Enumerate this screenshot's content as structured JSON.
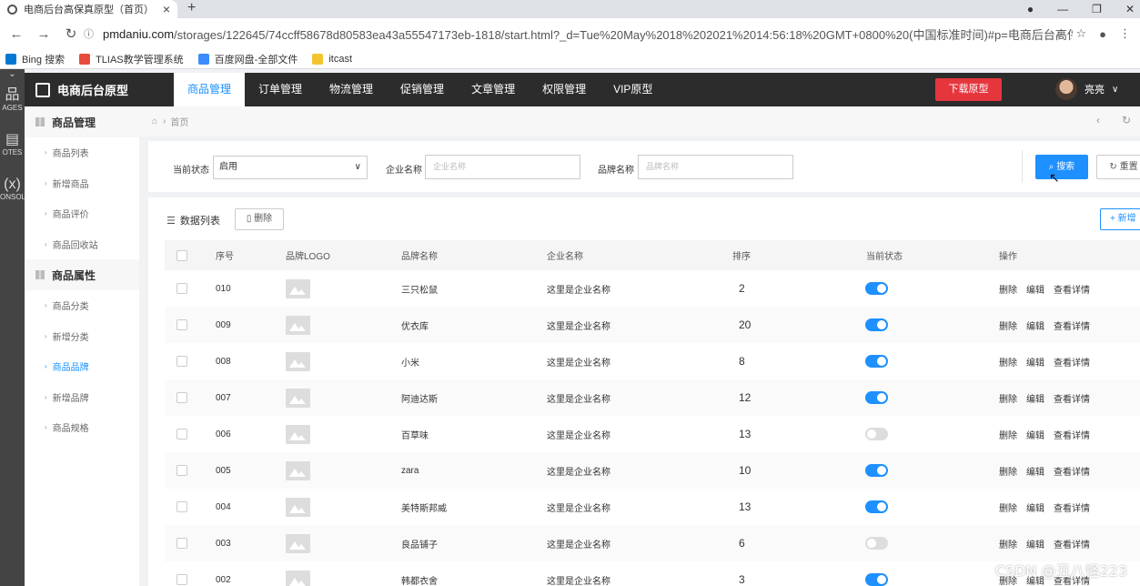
{
  "browser": {
    "tab_title": "电商后台高保真原型（首页）",
    "url_host": "pmdaniu.com",
    "url_path": "/storages/122645/74ccff58678d80583ea43a55547173eb-1818/start.html?_d=Tue%20May%2018%202021%2014:56:18%20GMT+0800%20(中国标准时间)#p=电商后台高保...",
    "bookmarks": [
      {
        "label": "Bing 搜索",
        "color": "#0078d4"
      },
      {
        "label": "TLIAS教学管理系统",
        "color": "#e74c3c"
      },
      {
        "label": "百度网盘-全部文件",
        "color": "#3b8cff"
      },
      {
        "label": "itcast",
        "color": "#f4c430"
      }
    ]
  },
  "axure": {
    "items": [
      {
        "glyph": "品",
        "label": "AGES"
      },
      {
        "glyph": "▤",
        "label": "OTES"
      },
      {
        "glyph": "(x)",
        "label": "ONSOL"
      }
    ]
  },
  "app": {
    "logo": "电商后台原型",
    "nav": [
      "商品管理",
      "订单管理",
      "物流管理",
      "促销管理",
      "文章管理",
      "权限管理",
      "VIP原型"
    ],
    "download": "下载原型",
    "user_name": "亮亮"
  },
  "sidebar": {
    "groups": [
      {
        "title": "商品管理",
        "items": [
          "商品列表",
          "新增商品",
          "商品评价",
          "商品回收站"
        ]
      },
      {
        "title": "商品属性",
        "items": [
          "商品分类",
          "新增分类",
          "商品品牌",
          "新增品牌",
          "商品规格"
        ]
      }
    ],
    "active": "商品品牌"
  },
  "breadcrumb": {
    "home_icon": "home-icon",
    "current": "首页"
  },
  "filter": {
    "status_label": "当前状态",
    "status_value": "启用",
    "company_label": "企业名称",
    "company_placeholder": "企业名称",
    "brand_label": "品牌名称",
    "brand_placeholder": "品牌名称",
    "search_btn": "搜索",
    "reset_btn": "重置"
  },
  "list": {
    "title": "数据列表",
    "delete_btn": "删除",
    "add_btn": "新增",
    "columns": [
      "序号",
      "品牌LOGO",
      "品牌名称",
      "企业名称",
      "排序",
      "当前状态",
      "操作"
    ],
    "ops": [
      "删除",
      "编辑",
      "查看详情"
    ],
    "rows": [
      {
        "id": "010",
        "brand": "三只松鼠",
        "company": "这里是企业名称",
        "sort": "2",
        "on": true
      },
      {
        "id": "009",
        "brand": "优衣库",
        "company": "这里是企业名称",
        "sort": "20",
        "on": true
      },
      {
        "id": "008",
        "brand": "小米",
        "company": "这里是企业名称",
        "sort": "8",
        "on": true
      },
      {
        "id": "007",
        "brand": "阿迪达斯",
        "company": "这里是企业名称",
        "sort": "12",
        "on": true
      },
      {
        "id": "006",
        "brand": "百草味",
        "company": "这里是企业名称",
        "sort": "13",
        "on": false
      },
      {
        "id": "005",
        "brand": "zara",
        "company": "这里是企业名称",
        "sort": "10",
        "on": true
      },
      {
        "id": "004",
        "brand": "美特斯邦威",
        "company": "这里是企业名称",
        "sort": "13",
        "on": true
      },
      {
        "id": "003",
        "brand": "良品铺子",
        "company": "这里是企业名称",
        "sort": "6",
        "on": false
      },
      {
        "id": "002",
        "brand": "韩都衣舍",
        "company": "这里是企业名称",
        "sort": "3",
        "on": true
      }
    ]
  },
  "watermark": "CSDN @丑八怪223"
}
